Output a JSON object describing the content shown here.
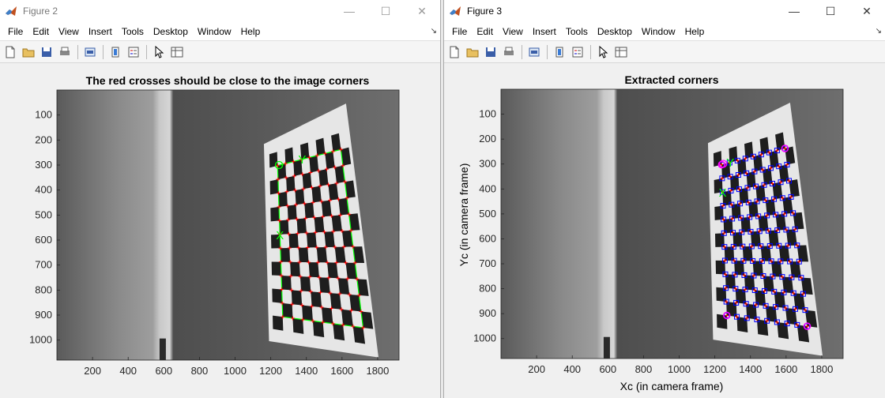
{
  "left_window": {
    "title": "Figure 2",
    "controls": [
      "—",
      "☐",
      "✕"
    ],
    "menus": [
      "File",
      "Edit",
      "View",
      "Insert",
      "Tools",
      "Desktop",
      "Window",
      "Help"
    ],
    "toolbar_icons": [
      "new-figure-icon",
      "open-icon",
      "save-icon",
      "print-icon",
      "link-plot-icon",
      "colorbar-icon",
      "legend-icon",
      "pointer-icon",
      "property-editor-icon"
    ],
    "plot": {
      "title": "The red crosses should be close to the image corners",
      "xlabel": "",
      "ylabel": "",
      "xticks": [
        "200",
        "400",
        "600",
        "800",
        "1000",
        "1200",
        "1400",
        "1600",
        "1800"
      ],
      "yticks": [
        "100",
        "200",
        "300",
        "400",
        "500",
        "600",
        "700",
        "800",
        "900",
        "1000"
      ],
      "markers": {
        "origin": "O",
        "x_axis": "X",
        "y_axis": "Y"
      }
    }
  },
  "right_window": {
    "title": "Figure 3",
    "controls": [
      "—",
      "☐",
      "✕"
    ],
    "menus": [
      "File",
      "Edit",
      "View",
      "Insert",
      "Tools",
      "Desktop",
      "Window",
      "Help"
    ],
    "toolbar_icons": [
      "new-figure-icon",
      "open-icon",
      "save-icon",
      "print-icon",
      "link-plot-icon",
      "colorbar-icon",
      "legend-icon",
      "pointer-icon",
      "property-editor-icon"
    ],
    "plot": {
      "title": "Extracted corners",
      "xlabel": "Xc (in camera frame)",
      "ylabel": "Yc (in camera frame)",
      "xticks": [
        "200",
        "400",
        "600",
        "800",
        "1000",
        "1200",
        "1400",
        "1600",
        "1800"
      ],
      "yticks": [
        "100",
        "200",
        "300",
        "400",
        "500",
        "600",
        "700",
        "800",
        "900",
        "1000"
      ],
      "markers": {
        "origin": "O",
        "x_axis": "X",
        "y_axis": "Y"
      }
    }
  },
  "colors": {
    "grid_line": "#00ff00",
    "corner_cross": "#ff0000",
    "corner_box": "#0000ff",
    "origin_marker": "#ff00ff"
  }
}
